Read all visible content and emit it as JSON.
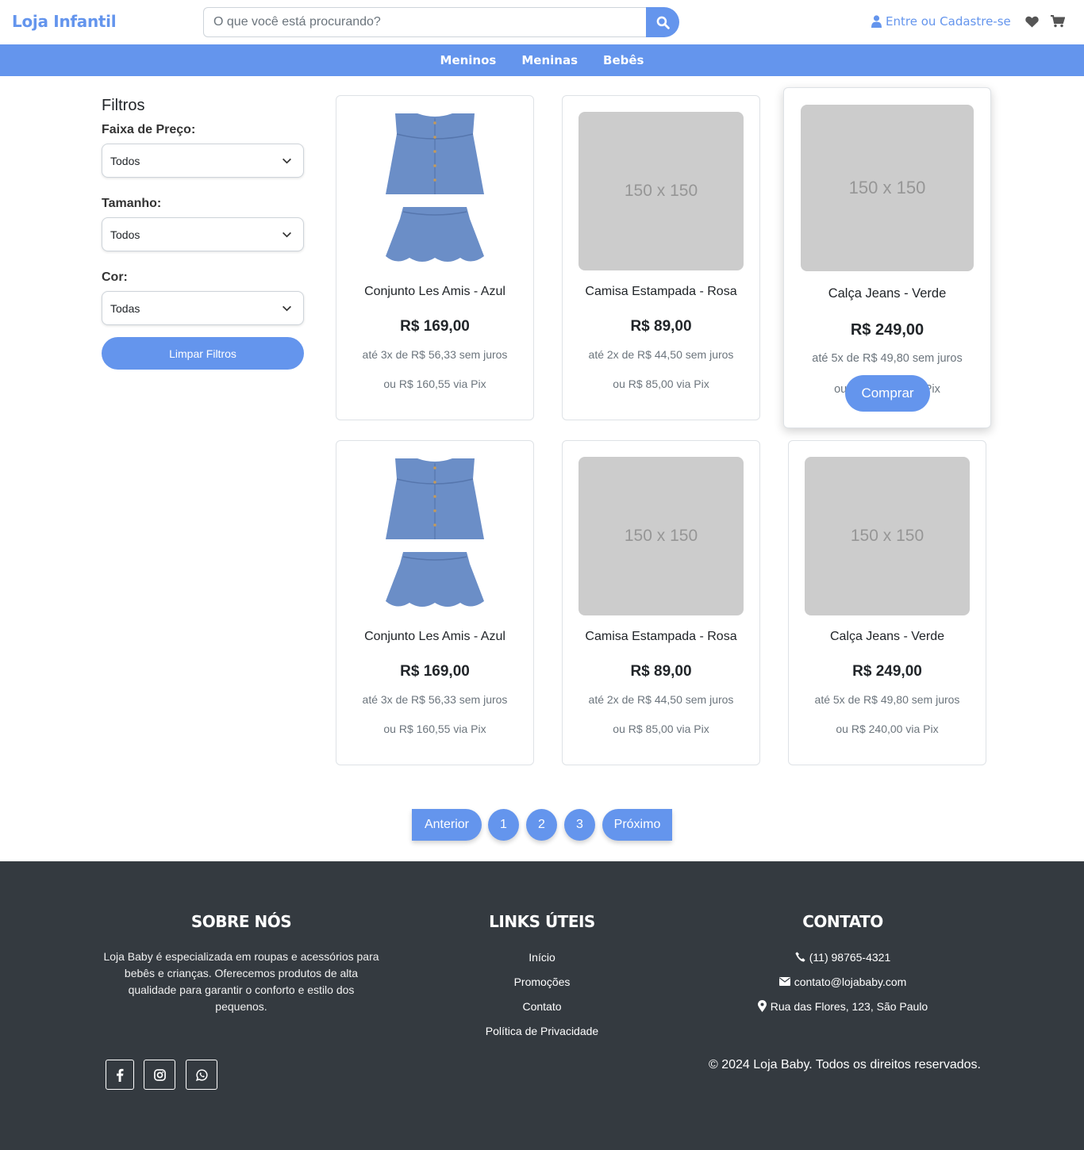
{
  "header": {
    "brand": "Loja Infantil",
    "search_placeholder": "O que você está procurando?",
    "login_label": "Entre ou Cadastre-se"
  },
  "nav": {
    "items": [
      "Meninos",
      "Meninas",
      "Bebês"
    ]
  },
  "filters": {
    "title": "Filtros",
    "price_label": "Faixa de Preço:",
    "price_value": "Todos",
    "size_label": "Tamanho:",
    "size_value": "Todos",
    "color_label": "Cor:",
    "color_value": "Todas",
    "clear_label": "Limpar Filtros"
  },
  "products": [
    {
      "name": "Conjunto Les Amis - Azul",
      "price": "R$ 169,00",
      "installments": "até 3x de R$ 56,33 sem juros",
      "pix": "ou R$ 160,55 via Pix",
      "image": "photo"
    },
    {
      "name": "Camisa Estampada - Rosa",
      "price": "R$ 89,00",
      "installments": "até 2x de R$ 44,50 sem juros",
      "pix": "ou R$ 85,00 via Pix",
      "image": "150 x 150"
    },
    {
      "name": "Calça Jeans - Verde",
      "price": "R$ 249,00",
      "installments": "até 5x de R$ 49,80 sem juros",
      "pix": "ou R$ 240,00 via Pix",
      "image": "150 x 150",
      "buy_label": "Comprar"
    },
    {
      "name": "Conjunto Les Amis - Azul",
      "price": "R$ 169,00",
      "installments": "até 3x de R$ 56,33 sem juros",
      "pix": "ou R$ 160,55 via Pix",
      "image": "photo"
    },
    {
      "name": "Camisa Estampada - Rosa",
      "price": "R$ 89,00",
      "installments": "até 2x de R$ 44,50 sem juros",
      "pix": "ou R$ 85,00 via Pix",
      "image": "150 x 150"
    },
    {
      "name": "Calça Jeans - Verde",
      "price": "R$ 249,00",
      "installments": "até 5x de R$ 49,80 sem juros",
      "pix": "ou R$ 240,00 via Pix",
      "image": "150 x 150"
    }
  ],
  "pagination": {
    "prev": "Anterior",
    "pages": [
      "1",
      "2",
      "3"
    ],
    "next": "Próximo"
  },
  "footer": {
    "about_title": "SOBRE NÓS",
    "about_text": "Loja Baby é especializada em roupas e acessórios para bebês e crianças. Oferecemos produtos de alta qualidade para garantir o conforto e estilo dos pequenos.",
    "links_title": "LINKS ÚTEIS",
    "links": [
      "Início",
      "Promoções",
      "Contato",
      "Política de Privacidade"
    ],
    "contact_title": "CONTATO",
    "phone": "(11) 98765-4321",
    "email": "contato@lojababy.com",
    "address": "Rua das Flores, 123, São Paulo",
    "social": [
      "facebook-icon",
      "instagram-icon",
      "whatsapp-icon"
    ],
    "copyright": "© 2024 Loja Baby. Todos os direitos reservados."
  },
  "colors": {
    "accent": "#6495ed",
    "footer_bg": "#343a40",
    "placeholder_bg": "#cccccc"
  }
}
